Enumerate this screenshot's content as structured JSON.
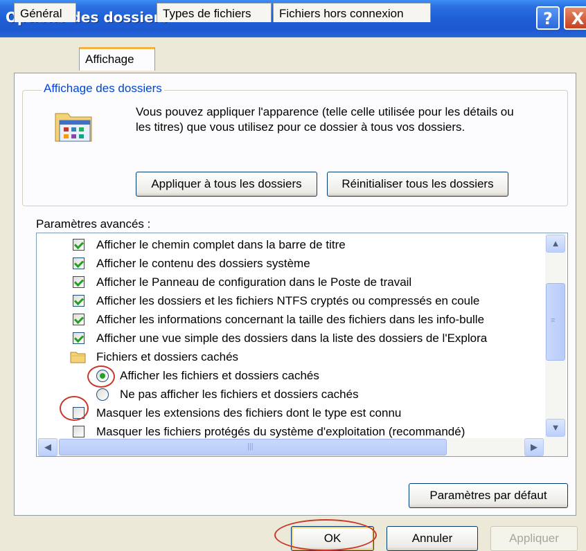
{
  "window": {
    "title": "Options des dossiers",
    "help_label": "?",
    "close_label": "X"
  },
  "tabs": [
    {
      "label": "Général",
      "active": false
    },
    {
      "label": "Affichage",
      "active": true
    },
    {
      "label": "Types de fichiers",
      "active": false
    },
    {
      "label": "Fichiers hors connexion",
      "active": false
    }
  ],
  "folder_view": {
    "group_label": "Affichage des dossiers",
    "description": "Vous pouvez appliquer l'apparence (telle celle utilisée pour les détails ou les titres) que vous utilisez pour ce dossier à tous vos dossiers.",
    "apply_all_label": "Appliquer à tous les dossiers",
    "reset_all_label": "Réinitialiser tous les dossiers"
  },
  "advanced": {
    "label": "Paramètres avancés :",
    "items": [
      {
        "type": "checkbox",
        "checked": true,
        "label": "Afficher le chemin complet dans la barre de titre"
      },
      {
        "type": "checkbox",
        "checked": true,
        "label": "Afficher le contenu des dossiers système"
      },
      {
        "type": "checkbox",
        "checked": true,
        "label": "Afficher le Panneau de configuration dans le Poste de travail"
      },
      {
        "type": "checkbox",
        "checked": true,
        "label": "Afficher les dossiers et les fichiers NTFS cryptés ou compressés en coule"
      },
      {
        "type": "checkbox",
        "checked": true,
        "label": "Afficher les informations concernant la taille des fichiers dans les info-bulle"
      },
      {
        "type": "checkbox",
        "checked": true,
        "label": "Afficher une vue simple des dossiers dans la liste des dossiers de l'Explora"
      },
      {
        "type": "folder",
        "label": "Fichiers et dossiers cachés"
      },
      {
        "type": "radio",
        "checked": true,
        "label": "Afficher les fichiers et dossiers cachés"
      },
      {
        "type": "radio",
        "checked": false,
        "label": "Ne pas afficher les fichiers et dossiers cachés"
      },
      {
        "type": "checkbox",
        "checked": false,
        "label": "Masquer les extensions des fichiers dont le type est connu"
      },
      {
        "type": "checkbox",
        "checked": false,
        "label": "Masquer les fichiers protégés du système d'exploitation (recommandé)"
      }
    ]
  },
  "defaults_label": "Paramètres par défaut",
  "footer": {
    "ok_label": "OK",
    "cancel_label": "Annuler",
    "apply_label": "Appliquer"
  },
  "colors": {
    "title_bar": "#1f5fd6",
    "annotation_circle": "#c8362a",
    "check_green": "#21a121"
  }
}
